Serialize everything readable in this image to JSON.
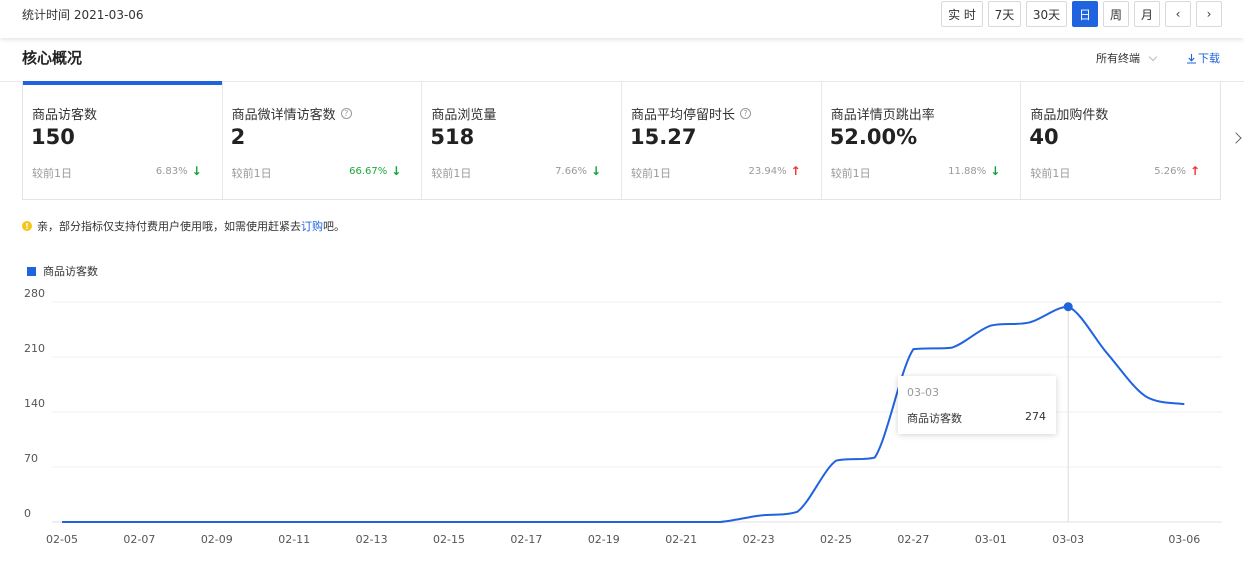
{
  "header": {
    "stat_time": "统计时间 2021-03-06",
    "ranges": [
      "实 时",
      "7天",
      "30天",
      "日",
      "周",
      "月"
    ],
    "active_range": "日",
    "prev_glyph": "‹",
    "next_glyph": "›"
  },
  "section": {
    "title": "核心概况",
    "terminal": "所有终端",
    "download": "下载",
    "download_icon": "download-icon"
  },
  "cards": [
    {
      "label": "商品访客数",
      "value": "150",
      "compare": "较前1日",
      "pct": "6.83%",
      "trend": "down",
      "help": false
    },
    {
      "label": "商品微详情访客数",
      "value": "2",
      "compare": "较前1日",
      "pct": "66.67%",
      "trend": "down",
      "help": true
    },
    {
      "label": "商品浏览量",
      "value": "518",
      "compare": "较前1日",
      "pct": "7.66%",
      "trend": "down",
      "help": false
    },
    {
      "label": "商品平均停留时长",
      "value": "15.27",
      "compare": "较前1日",
      "pct": "23.94%",
      "trend": "up",
      "help": true
    },
    {
      "label": "商品详情页跳出率",
      "value": "52.00%",
      "compare": "较前1日",
      "pct": "11.88%",
      "trend": "down",
      "help": false
    },
    {
      "label": "商品加购件数",
      "value": "40",
      "compare": "较前1日",
      "pct": "5.26%",
      "trend": "up",
      "help": false
    }
  ],
  "colors": {
    "accent": "#1f63de",
    "down": "#12a33b",
    "up": "#f2322b",
    "notice": "#f5c518"
  },
  "notice": {
    "icon": "exclamation-icon",
    "before": "亲，部分指标仅支持付费用户使用哦，如需使用赶紧去",
    "link": "订购",
    "after": "吧。"
  },
  "tooltip": {
    "date": "03-03",
    "series": "商品访客数",
    "value": "274"
  },
  "chart_data": {
    "type": "line",
    "title": "",
    "xlabel": "",
    "ylabel": "",
    "legend": "top-left",
    "grid": true,
    "ylim": [
      0,
      280
    ],
    "yticks": [
      0,
      70,
      140,
      210,
      280
    ],
    "x": [
      "02-05",
      "02-06",
      "02-07",
      "02-08",
      "02-09",
      "02-10",
      "02-11",
      "02-12",
      "02-13",
      "02-14",
      "02-15",
      "02-16",
      "02-17",
      "02-18",
      "02-19",
      "02-20",
      "02-21",
      "02-22",
      "02-23",
      "02-24",
      "02-25",
      "02-26",
      "02-27",
      "02-28",
      "03-01",
      "03-02",
      "03-03",
      "03-04",
      "03-05",
      "03-06"
    ],
    "xticks": [
      "02-05",
      "02-07",
      "02-09",
      "02-11",
      "02-13",
      "02-15",
      "02-17",
      "02-19",
      "02-21",
      "02-23",
      "02-25",
      "02-27",
      "03-01",
      "03-03",
      "03-06"
    ],
    "series": [
      {
        "name": "商品访客数",
        "values": [
          0,
          0,
          0,
          0,
          0,
          0,
          0,
          0,
          0,
          0,
          0,
          0,
          0,
          0,
          0,
          0,
          0,
          0,
          8,
          13,
          78,
          82,
          220,
          222,
          250,
          254,
          274,
          215,
          160,
          150
        ]
      }
    ],
    "highlight": "03-03"
  }
}
